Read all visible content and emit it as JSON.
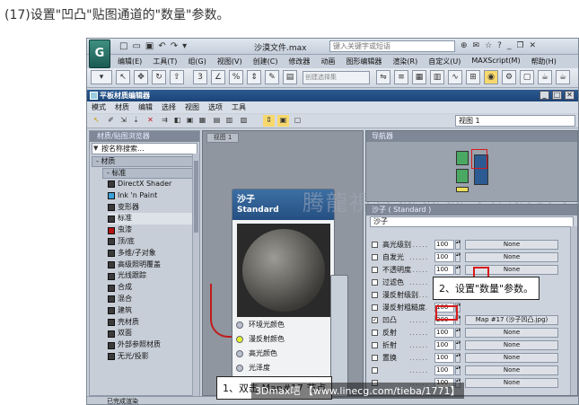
{
  "caption": "(17)设置\"凹凸\"贴图通道的\"数量\"参数。",
  "app": {
    "logo": "G",
    "title": "沙漠文件.max",
    "search_placeholder": "键入关键字或短语",
    "menu": [
      "编辑(E)",
      "工具(T)",
      "组(G)",
      "视图(V)",
      "创建(C)",
      "修改器",
      "动画",
      "图形编辑器",
      "渲染(R)",
      "自定义(U)",
      "MAXScript(M)",
      "帮助(H)"
    ],
    "selection_set": "创建选择集"
  },
  "sme": {
    "title": "平板材质编辑器",
    "menu": [
      "模式",
      "材质",
      "编辑",
      "选择",
      "视图",
      "选项",
      "工具"
    ],
    "view_dropdown": "视图 1"
  },
  "browser": {
    "header": "材质/贴图浏览器",
    "search": "按名称搜索...",
    "category": "- 材质",
    "subcategory": "- 标准",
    "items": [
      "DirectX Shader",
      "Ink 'n Paint",
      "变形器",
      "标准",
      "虫漆",
      "顶/底",
      "多维/子对象",
      "高级照明覆盖",
      "光线跟踪",
      "合成",
      "混合",
      "建筑",
      "壳材质",
      "双面",
      "外部参照材质",
      "无光/投影"
    ]
  },
  "view": {
    "tab": "视图 1",
    "node": {
      "title": "沙子",
      "type": "Standard",
      "slots": [
        "环境光颜色",
        "漫反射颜色",
        "高光颜色",
        "光泽度"
      ]
    }
  },
  "navigator": {
    "header": "导航器"
  },
  "props": {
    "header": "沙子 ( Standard )",
    "name": "沙子",
    "rows": [
      {
        "label": "高光级别",
        "value": "100",
        "map": "None",
        "checked": false
      },
      {
        "label": "自发光",
        "value": "100",
        "map": "None",
        "checked": false
      },
      {
        "label": "不透明度",
        "value": "100",
        "map": "None",
        "checked": false
      },
      {
        "label": "过滤色",
        "value": "100",
        "map": "",
        "checked": false
      },
      {
        "label": "漫反射级别",
        "value": "100",
        "map": "",
        "checked": false
      },
      {
        "label": "漫反射粗糙度",
        "value": "100",
        "map": "",
        "checked": false
      },
      {
        "label": "凹凸",
        "value": "200",
        "map": "Map #17 (沙子凹凸.jpg)",
        "checked": true
      },
      {
        "label": "反射",
        "value": "100",
        "map": "None",
        "checked": false
      },
      {
        "label": "折射",
        "value": "100",
        "map": "None",
        "checked": false
      },
      {
        "label": "置换",
        "value": "100",
        "map": "None",
        "checked": false
      },
      {
        "label": "",
        "value": "100",
        "map": "None",
        "checked": false
      },
      {
        "label": "",
        "value": "100",
        "map": "None",
        "checked": false
      }
    ]
  },
  "status": "已完成渲染",
  "callouts": {
    "step1": "1、双击 Map#17 节点",
    "step2": "2、设置\"数量\"参数。"
  },
  "watermark": "腾龍視覺WWW.TENGLONG.NET",
  "bottom_watermark": "3Dmax吧 【www.linecg.com/tieba/1771】",
  "colors": {
    "accent": "#244f82",
    "highlight": "#d81b1b",
    "active_slot": "#e2f52a"
  }
}
